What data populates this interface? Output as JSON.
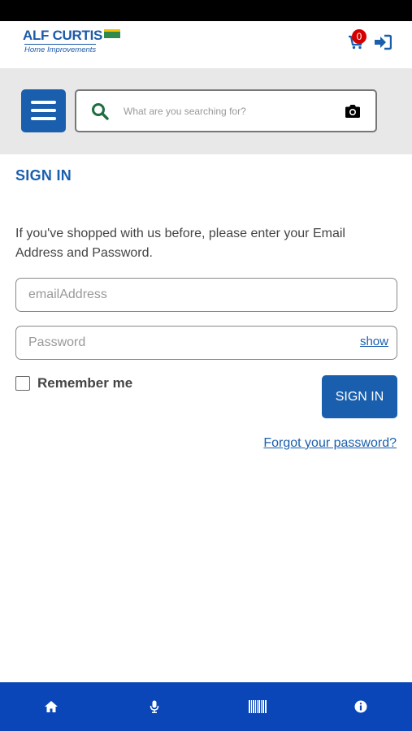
{
  "header": {
    "logo_line1": "ALF CURTIS",
    "logo_line2": "Home Improvements",
    "cart_count": "0",
    "icons": [
      "cart-icon",
      "sign-in-icon"
    ]
  },
  "search": {
    "placeholder": "What are you searching for?",
    "icons": [
      "menu-icon",
      "search-icon",
      "camera-icon"
    ]
  },
  "page": {
    "title": "SIGN IN",
    "intro": "If you've shopped with us before, please enter your Email Address and Password."
  },
  "form": {
    "email_placeholder": "emailAddress",
    "email_value": "",
    "password_placeholder": "Password",
    "password_value": "",
    "show_label": "show",
    "remember_label": "Remember me",
    "remember_checked": false,
    "submit_label": "SIGN IN",
    "forgot_label": "Forgot your password?"
  },
  "bottom_nav": {
    "items": [
      "home-icon",
      "microphone-icon",
      "barcode-icon",
      "info-icon"
    ]
  },
  "colors": {
    "brand_blue": "#1a5fad",
    "nav_blue": "#0a46b8",
    "search_icon_green": "#1e6e3f",
    "badge_red": "#d40000"
  }
}
